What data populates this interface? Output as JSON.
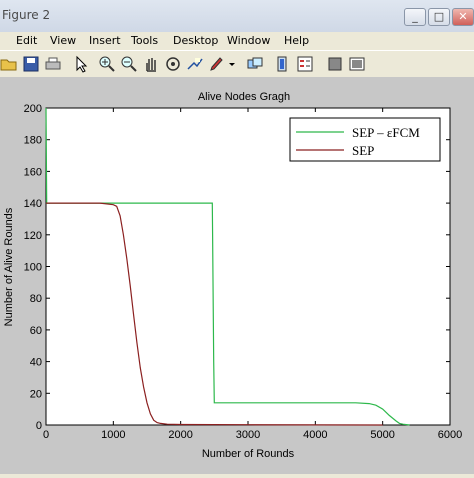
{
  "window": {
    "title": "Figure 2",
    "minimize": "_",
    "maximize": "□",
    "close": "✕"
  },
  "menu": [
    "Edit",
    "View",
    "Insert",
    "Tools",
    "Desktop",
    "Window",
    "Help"
  ],
  "toolbar_icons": [
    "open-icon",
    "save-icon",
    "print-icon",
    "select-arrow-icon",
    "zoom-in-icon",
    "zoom-out-icon",
    "pan-icon",
    "rotate-icon",
    "data-cursor-icon",
    "brush-icon",
    "link-icon",
    "colorbar-icon",
    "legend-icon",
    "hide-plot-tools-icon",
    "show-plot-tools-icon"
  ],
  "chart_data": {
    "type": "line",
    "title": "Alive Nodes Gragh",
    "xlabel": "Number of Rounds",
    "ylabel": "Number of Alive Rounds",
    "xlim": [
      0,
      6000
    ],
    "ylim": [
      0,
      200
    ],
    "xticks": [
      "0",
      "1000",
      "2000",
      "3000",
      "4000",
      "5000",
      "6000"
    ],
    "yticks": [
      "0",
      "20",
      "40",
      "60",
      "80",
      "100",
      "120",
      "140",
      "160",
      "180",
      "200"
    ],
    "grid": false,
    "legend_position": "top-right",
    "series": [
      {
        "name": "SEP – εFCM",
        "color": "#2db84b",
        "x": [
          0,
          10,
          2470,
          2475,
          2490,
          2500,
          4600,
          4800,
          4900,
          5000,
          5100,
          5200,
          5250,
          5300,
          5400
        ],
        "y": [
          200,
          140,
          140,
          120,
          40,
          14,
          14,
          13.5,
          12.5,
          10,
          6,
          2.5,
          1,
          0.5,
          0
        ]
      },
      {
        "name": "SEP",
        "color": "#8b2020",
        "x": [
          0,
          800,
          1000,
          1050,
          1100,
          1150,
          1200,
          1250,
          1300,
          1350,
          1400,
          1450,
          1500,
          1550,
          1600,
          1650,
          1700,
          1800,
          2000,
          3000,
          5000
        ],
        "y": [
          140,
          140,
          139,
          138,
          132,
          120,
          105,
          88,
          70,
          52,
          36,
          24,
          14,
          7,
          3,
          1.5,
          1,
          0.5,
          0.3,
          0.2,
          0
        ]
      }
    ]
  }
}
